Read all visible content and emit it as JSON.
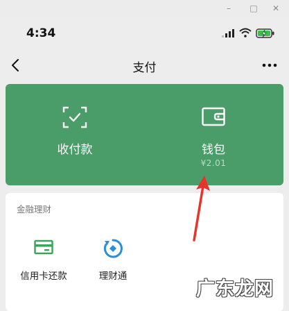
{
  "window": {
    "minimize_glyph": "–",
    "maximize_glyph": "□",
    "close_glyph": "✕"
  },
  "status_bar": {
    "time": "4:34",
    "icons": [
      "signal-icon",
      "wifi-icon",
      "battery-charging-icon"
    ]
  },
  "nav": {
    "title": "支付",
    "back_icon": "chevron-left-icon",
    "more_icon": "more-dots-icon"
  },
  "top_card": {
    "background": "#4a9d68",
    "left": {
      "label": "收付款",
      "icon": "scan-check-icon"
    },
    "right": {
      "label": "钱包",
      "balance": "¥2.01",
      "icon": "wallet-icon"
    }
  },
  "finance": {
    "section_title": "金融理财",
    "items": [
      {
        "label": "信用卡还款",
        "icon": "credit-card-icon",
        "color": "#3ca35a"
      },
      {
        "label": "理财通",
        "icon": "licaitong-icon",
        "color": "#2a8fd8"
      }
    ]
  },
  "annotation": {
    "arrow_color": "#e8322a"
  },
  "watermark": "广东龙网"
}
